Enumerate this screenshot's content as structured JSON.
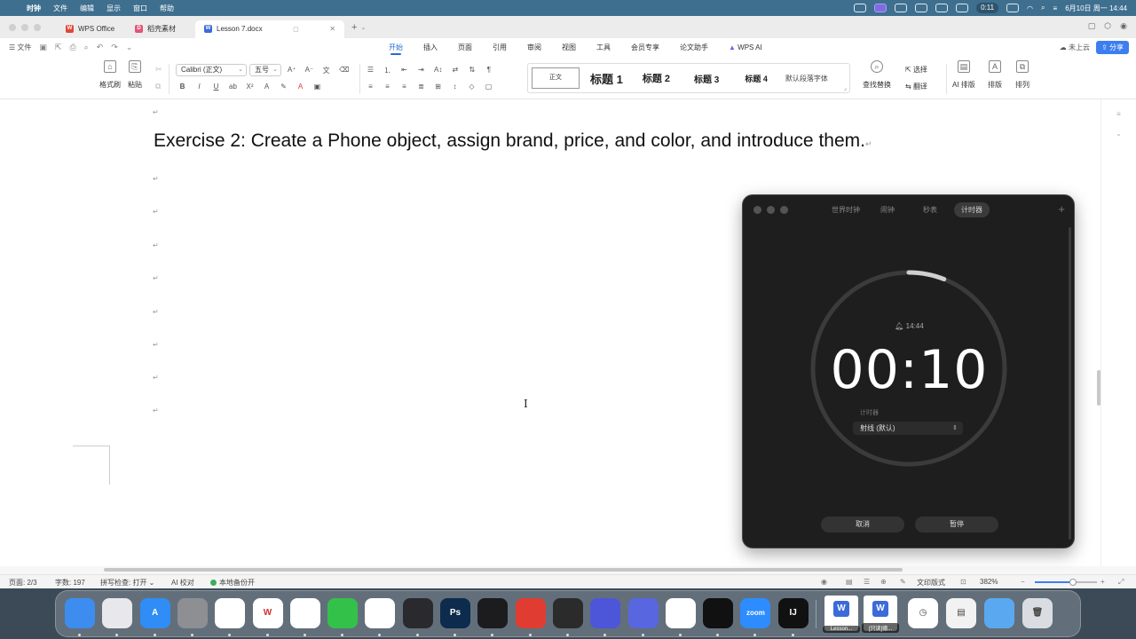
{
  "menubar": {
    "app": "时钟",
    "items": [
      "文件",
      "编辑",
      "显示",
      "窗口",
      "帮助"
    ],
    "timer_pill": "0:11",
    "datetime": "6月10日 周一 14:44"
  },
  "tabs": {
    "items": [
      {
        "label": "WPS Office",
        "icon": "wps-logo-icon",
        "color": "#e2463b"
      },
      {
        "label": "稻壳素材",
        "icon": "docer-icon",
        "color": "#e05577"
      },
      {
        "label": "Lesson 7.docx",
        "icon": "word-doc-icon",
        "color": "#3a6bd8"
      }
    ]
  },
  "ribbon": {
    "file_menu": "文件",
    "tabs": [
      "开始",
      "插入",
      "页面",
      "引用",
      "审阅",
      "视图",
      "工具",
      "会员专享",
      "论文助手",
      "WPS AI"
    ],
    "active_tab": "开始",
    "cloud": "未上云",
    "share": "分享"
  },
  "toolbar": {
    "format_painter": "格式刷",
    "paste": "粘贴",
    "font_name": "Calibri (正文)",
    "font_size": "五号",
    "styles": {
      "normal": "正文",
      "h1": "标题 1",
      "h2": "标题 2",
      "h3": "标题 3",
      "h4": "标题 4",
      "default_para": "默认段落字体"
    },
    "find_replace": "查找替换",
    "select": "选择",
    "translate": "翻译",
    "ai_layout": "AI 排版",
    "layout": "排版",
    "arrange": "排列"
  },
  "document": {
    "heading": "Exercise 2: Create a Phone object, assign brand, price, and color, and introduce them.",
    "para_mark": "↵"
  },
  "statusbar": {
    "page": "页面: 2/3",
    "word_count": "字数: 197",
    "spell_check": "拼写检查: 打开",
    "ai_proof": "AI 校对",
    "backup": "本地备份开",
    "view_mode": "文印版式",
    "zoom": "382%",
    "zoom_fraction": 0.62
  },
  "clock": {
    "segments": [
      "世界时钟",
      "闹钟",
      "秒表",
      "计时器"
    ],
    "active_segment": "计时器",
    "alarm_time": "14:44",
    "time_remaining": "00:10",
    "timer_label": "计时器",
    "sound": "射线 (默认)",
    "cancel": "取消",
    "pause": "暂停",
    "progress_remaining_fraction": 0.06
  },
  "dock": {
    "apps": [
      {
        "name": "finder-icon",
        "label": "",
        "color": "#3d8df0"
      },
      {
        "name": "launchpad-icon",
        "label": "",
        "color": "#e8e8ec"
      },
      {
        "name": "app-store-icon",
        "label": "A",
        "color": "#2f8df5"
      },
      {
        "name": "system-settings-icon",
        "label": "",
        "color": "#8d8f93"
      },
      {
        "name": "chrome-icon",
        "label": "",
        "color": "#ffffff"
      },
      {
        "name": "wps-dock-icon",
        "label": "W",
        "color": "#ffffff"
      },
      {
        "name": "baidu-netdisk-icon",
        "label": "",
        "color": "#ffffff"
      },
      {
        "name": "wechat-icon",
        "label": "",
        "color": "#33c14a"
      },
      {
        "name": "qq-icon",
        "label": "",
        "color": "#ffffff"
      },
      {
        "name": "davinci-icon",
        "label": "",
        "color": "#2a2a2e"
      },
      {
        "name": "photoshop-icon",
        "label": "Ps",
        "color": "#0d2b4d"
      },
      {
        "name": "final-cut-icon",
        "label": "",
        "color": "#1c1c1e"
      },
      {
        "name": "netease-music-icon",
        "label": "",
        "color": "#e03c31"
      },
      {
        "name": "keynote-icon",
        "label": "",
        "color": "#2b2b2b"
      },
      {
        "name": "terminal-icon",
        "label": "",
        "color": "#4d56d9"
      },
      {
        "name": "powershell-icon",
        "label": "",
        "color": "#5866e0"
      },
      {
        "name": "rocket-icon",
        "label": "",
        "color": "#ffffff"
      },
      {
        "name": "tiktok-icon",
        "label": "",
        "color": "#111111"
      },
      {
        "name": "zoom-icon",
        "label": "zoom",
        "color": "#2d8cff"
      },
      {
        "name": "intellij-icon",
        "label": "IJ",
        "color": "#111111"
      }
    ],
    "thumbs": [
      {
        "label": "Lesson..."
      },
      {
        "label": "[只读]德..."
      }
    ]
  }
}
